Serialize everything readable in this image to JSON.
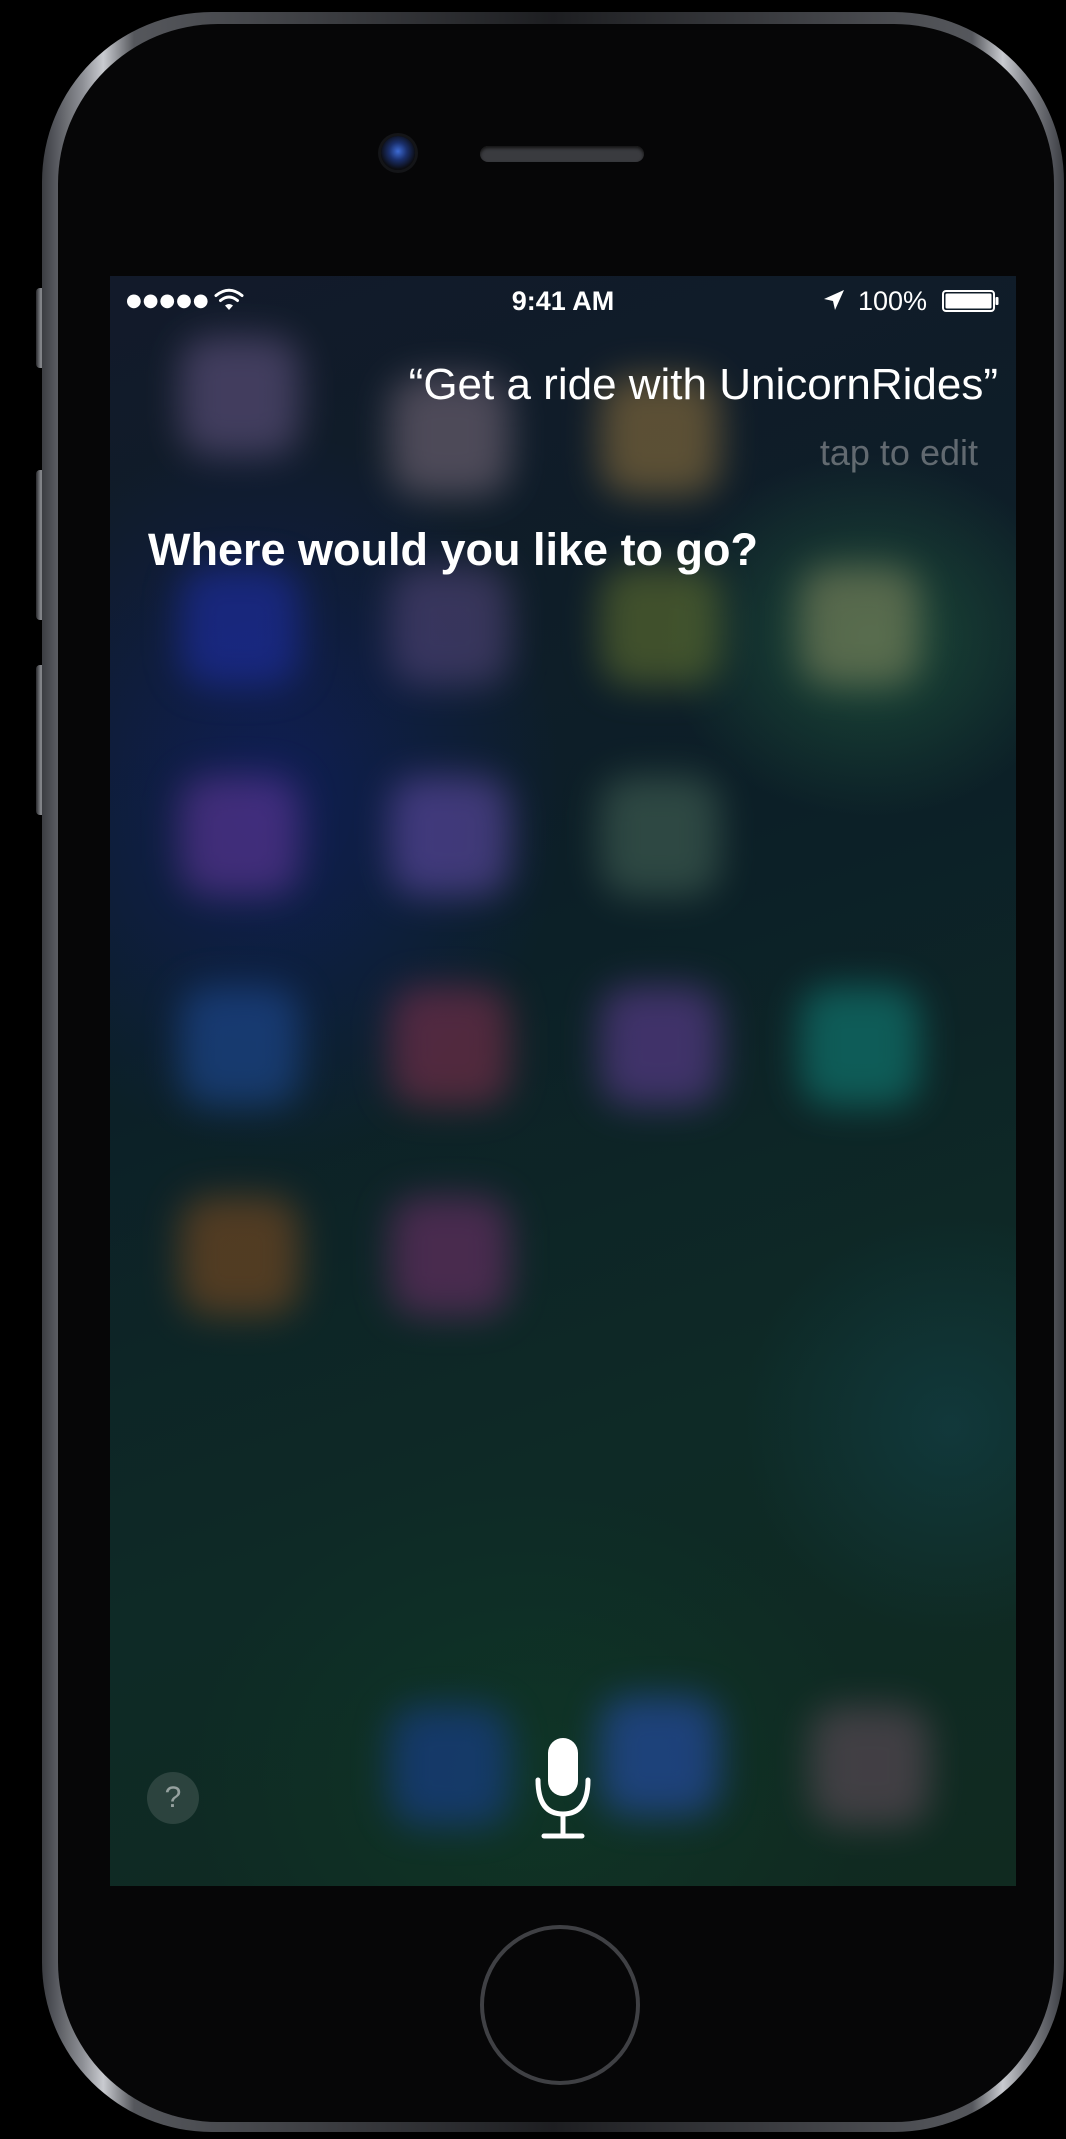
{
  "status_bar": {
    "signal": "●●●●●",
    "time": "9:41 AM",
    "battery_percent": "100%"
  },
  "siri": {
    "query": "“Get a ride with UnicornRides”",
    "edit_hint": "tap to edit",
    "response": "Where would you like to go?",
    "help_label": "?"
  },
  "icons": {
    "wifi": "wifi-icon",
    "location": "location-arrow-icon",
    "battery": "battery-icon",
    "microphone": "microphone-icon",
    "help": "question-mark-icon"
  },
  "colors": {
    "text_primary": "#ffffff",
    "text_hint": "#8a8f8c",
    "screen_tint": "#0d1f1d"
  }
}
